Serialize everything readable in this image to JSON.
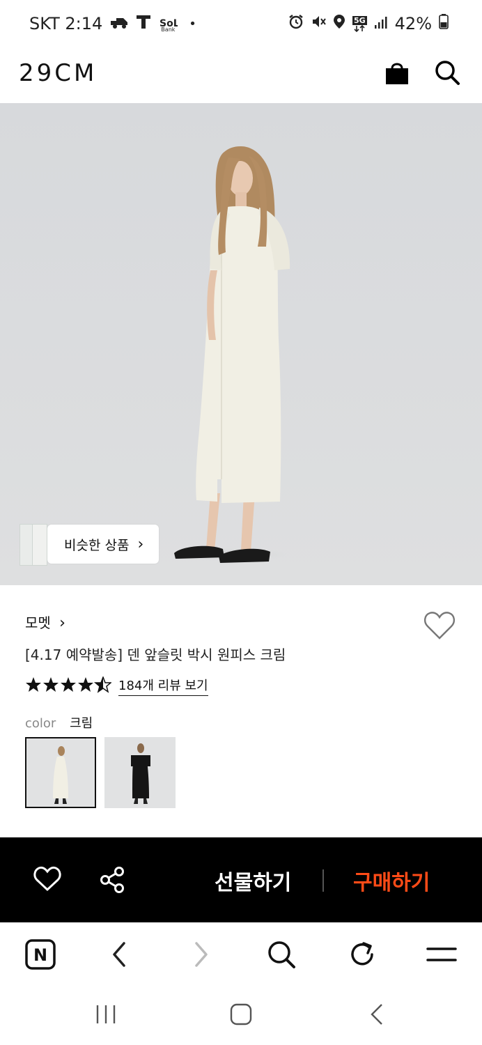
{
  "status_bar": {
    "carrier_time": "SKT 2:14",
    "app_icons": [
      "delivery-icon",
      "tmap-icon",
      "sol-bank-icon"
    ],
    "sol_bank_label": "Bank",
    "dot": "•",
    "right_icons": [
      "alarm-icon",
      "mute-icon",
      "location-icon",
      "5g-icon",
      "signal-icon"
    ],
    "network": "5G",
    "battery": "42%"
  },
  "header": {
    "logo": "29CM",
    "icons": [
      "shopping-bag-icon",
      "search-icon"
    ]
  },
  "hero": {
    "similar_label": "비슷한 상품",
    "similar_chevron": "›"
  },
  "product": {
    "brand": "모멧",
    "brand_chevron": "›",
    "title": "[4.17 예약발송] 덴 앞슬릿 박시 원피스 크림",
    "rating_stars": 4.5,
    "review_link": "184개 리뷰 보기",
    "color_label": "color",
    "color_value": "크림",
    "swatches": [
      {
        "name": "크림",
        "selected": true,
        "dress_color": "#f1efe4"
      },
      {
        "name": "블랙",
        "selected": false,
        "dress_color": "#151515"
      }
    ]
  },
  "action_bar": {
    "gift_label": "선물하기",
    "buy_label": "구매하기",
    "buy_color": "#ff4b17"
  },
  "browser_bar": {
    "icons": [
      "naver-icon",
      "back-icon",
      "forward-icon",
      "search-icon",
      "refresh-icon",
      "menu-icon"
    ],
    "naver_letter": "N"
  },
  "nav_bar": {
    "icons": [
      "recent-apps-icon",
      "home-icon",
      "nav-back-icon"
    ]
  }
}
